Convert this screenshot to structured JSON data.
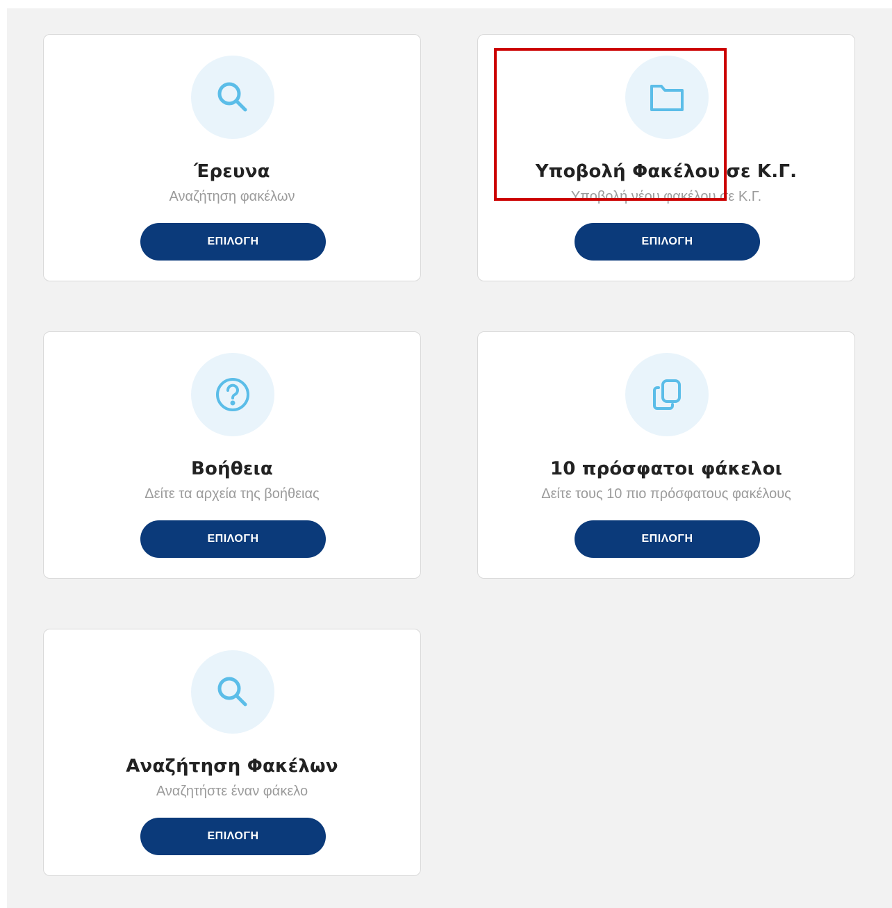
{
  "colors": {
    "page_background": "#f2f2f2",
    "card_background": "#ffffff",
    "icon_circle": "#e9f4fb",
    "icon_stroke": "#5bbde8",
    "button": "#0b3a7a",
    "button_text": "#ffffff",
    "title_text": "#222222",
    "subtitle_text": "#9b9b9b",
    "highlight": "#cc0000"
  },
  "cards": [
    {
      "icon": "search-icon",
      "title": "Έρευνα",
      "subtitle": "Αναζήτηση φακέλων",
      "button_label": "ΕΠΙΛΟΓΗ"
    },
    {
      "icon": "folder-icon",
      "title": "Υποβολή Φακέλου σε Κ.Γ.",
      "subtitle": "Υποβολή νέου φακέλου σε Κ.Γ.",
      "button_label": "ΕΠΙΛΟΓΗ"
    },
    {
      "icon": "help-icon",
      "title": "Βοήθεια",
      "subtitle": "Δείτε τα αρχεία της βοήθειας",
      "button_label": "ΕΠΙΛΟΓΗ"
    },
    {
      "icon": "copy-icon",
      "title": "10 πρόσφατοι φάκελοι",
      "subtitle": "Δείτε τους 10 πιο πρόσφατους φακέλους",
      "button_label": "ΕΠΙΛΟΓΗ"
    },
    {
      "icon": "search-icon",
      "title": "Αναζήτηση Φακέλων",
      "subtitle": "Αναζητήστε έναν φάκελο",
      "button_label": "ΕΠΙΛΟΓΗ"
    }
  ]
}
